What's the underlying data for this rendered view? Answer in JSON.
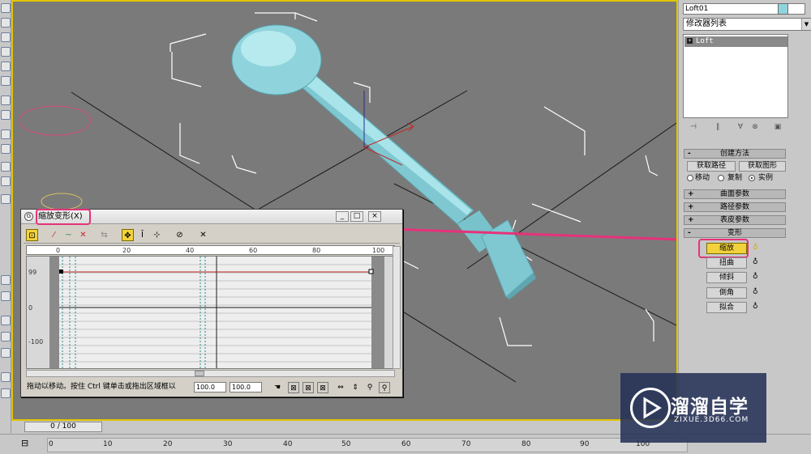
{
  "command_panel": {
    "object_name": "Loft01",
    "object_color": "#8fd4dc",
    "modifier_list": "修改器列表",
    "stack_item": "Loft",
    "creation_method": {
      "title": "创建方法",
      "get_path": "获取路径",
      "get_shape": "获取图形",
      "options": [
        "移动",
        "复制",
        "实例"
      ],
      "selected": "实例"
    },
    "rollouts": [
      "曲面参数",
      "路径参数",
      "表皮参数",
      "变形"
    ],
    "deformations": [
      {
        "label": "缩放",
        "active": true
      },
      {
        "label": "扭曲",
        "active": false
      },
      {
        "label": "倾斜",
        "active": false
      },
      {
        "label": "倒角",
        "active": false
      },
      {
        "label": "拟合",
        "active": false
      }
    ]
  },
  "deform_window": {
    "title": "缩放变形(X)",
    "ruler_ticks": [
      "0",
      "20",
      "40",
      "60",
      "80",
      "100"
    ],
    "y_labels": [
      "99",
      "0",
      "-100"
    ],
    "curve_value": 99,
    "status": "拖动以移动。按住 Ctrl 键单击或拖出区域框以",
    "field1": "100.0",
    "field2": "100.0"
  },
  "timeline": {
    "slider": "0 / 100",
    "frames": [
      "0",
      "10",
      "20",
      "30",
      "40",
      "50",
      "60",
      "70",
      "80",
      "90",
      "100"
    ]
  },
  "watermark": {
    "title": "溜溜自学",
    "subtitle": "ZIXUE.3D66.COM"
  },
  "colors": {
    "accent": "#e6327a",
    "model": "#8fd4dc",
    "viewport_border": "#e2c400"
  }
}
